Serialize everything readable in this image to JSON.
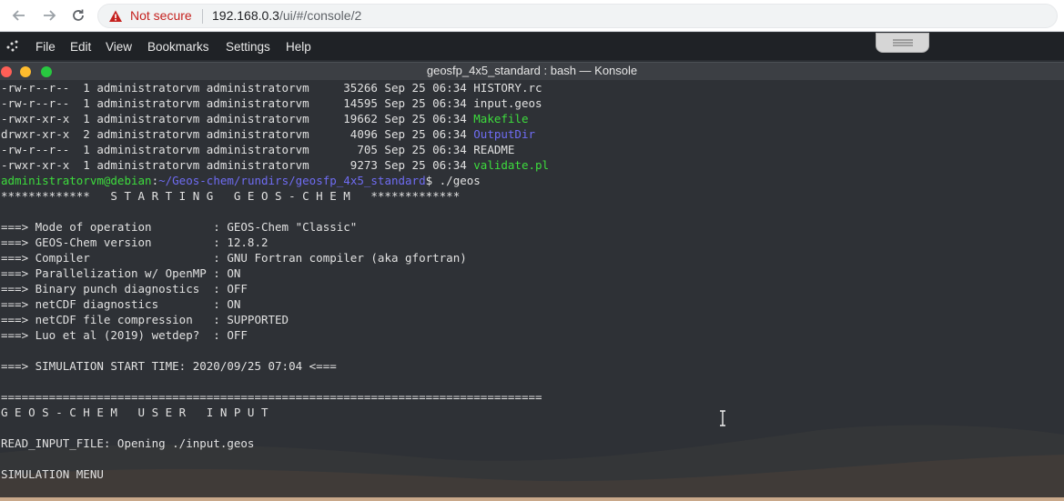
{
  "browser": {
    "security_label": "Not secure",
    "url_host": "192.168.0.3",
    "url_path": "/ui/#/console/2",
    "back_icon": "arrow-left-icon",
    "forward_icon": "arrow-right-icon",
    "reload_icon": "reload-icon"
  },
  "menubar": {
    "items": [
      "File",
      "Edit",
      "View",
      "Bookmarks",
      "Settings",
      "Help"
    ]
  },
  "window": {
    "title": "geosfp_4x5_standard : bash — Konsole",
    "controls": {
      "close_color": "#ff5f57",
      "minimize_color": "#febc2e",
      "maximize_color": "#28c840"
    }
  },
  "terminal": {
    "listing": [
      {
        "perms": "-rw-r--r--",
        "links": "1",
        "owner": "administratorvm",
        "group": "administratorvm",
        "size": "35266",
        "date": "Sep 25 06:34",
        "name": "HISTORY.rc",
        "kind": "file"
      },
      {
        "perms": "-rw-r--r--",
        "links": "1",
        "owner": "administratorvm",
        "group": "administratorvm",
        "size": "14595",
        "date": "Sep 25 06:34",
        "name": "input.geos",
        "kind": "file"
      },
      {
        "perms": "-rwxr-xr-x",
        "links": "1",
        "owner": "administratorvm",
        "group": "administratorvm",
        "size": "19662",
        "date": "Sep 25 06:34",
        "name": "Makefile",
        "kind": "exec"
      },
      {
        "perms": "drwxr-xr-x",
        "links": "2",
        "owner": "administratorvm",
        "group": "administratorvm",
        "size": "4096",
        "date": "Sep 25 06:34",
        "name": "OutputDir",
        "kind": "dir"
      },
      {
        "perms": "-rw-r--r--",
        "links": "1",
        "owner": "administratorvm",
        "group": "administratorvm",
        "size": "705",
        "date": "Sep 25 06:34",
        "name": "README",
        "kind": "file"
      },
      {
        "perms": "-rwxr-xr-x",
        "links": "1",
        "owner": "administratorvm",
        "group": "administratorvm",
        "size": "9273",
        "date": "Sep 25 06:34",
        "name": "validate.pl",
        "kind": "exec"
      }
    ],
    "prompt_user": "administratorvm@debian",
    "prompt_path": "~/Geos-chem/rundirs/geosfp_4x5_standard",
    "prompt_command": "$ ./geos",
    "banner": "*************   S T A R T I N G   G E O S - C H E M   *************",
    "settings": [
      {
        "label": "===> Mode of operation         ",
        "value": ": GEOS-Chem \"Classic\""
      },
      {
        "label": "===> GEOS-Chem version         ",
        "value": ": 12.8.2"
      },
      {
        "label": "===> Compiler                  ",
        "value": ": GNU Fortran compiler (aka gfortran)"
      },
      {
        "label": "===> Parallelization w/ OpenMP ",
        "value": ": ON"
      },
      {
        "label": "===> Binary punch diagnostics  ",
        "value": ": OFF"
      },
      {
        "label": "===> netCDF diagnostics        ",
        "value": ": ON"
      },
      {
        "label": "===> netCDF file compression   ",
        "value": ": SUPPORTED"
      },
      {
        "label": "===> Luo et al (2019) wetdep?  ",
        "value": ": OFF"
      }
    ],
    "start_time": "===> SIMULATION START TIME: 2020/09/25 07:04 <===",
    "separator": "===============================================================================",
    "user_input_header": "G E O S - C H E M   U S E R   I N P U T",
    "read_input": "READ_INPUT_FILE: Opening ./input.geos",
    "sim_menu": "SIMULATION MENU"
  },
  "colors": {
    "terminal_bg": "#2e3136",
    "terminal_fg": "#e1e1e1",
    "exec_green": "#3ddc3d",
    "dir_blue": "#6f6cf3",
    "warning_red": "#c5221f"
  }
}
